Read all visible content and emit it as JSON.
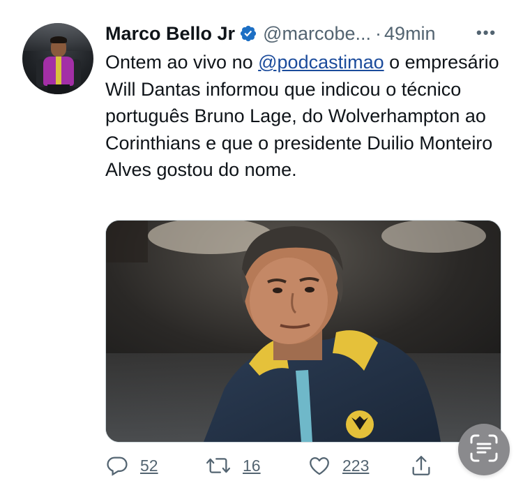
{
  "tweet": {
    "author_name": "Marco Bello Jr",
    "handle": "@marcobe...",
    "separator": "·",
    "time": "49min",
    "more_label": "•••",
    "text_before_mention": "Ontem ao vivo no ",
    "mention": "@podcastimao",
    "text_after_mention": " o empresário Will Dantas informou que indicou o técnico português Bruno Lage, do Wolverhampton ao Corinthians e que o presidente Duilio Monteiro Alves gostou do nome."
  },
  "actions": {
    "reply_count": "52",
    "retweet_count": "16",
    "like_count": "223"
  },
  "icons": {
    "verified": "verified-badge-icon",
    "reply": "reply-icon",
    "retweet": "retweet-icon",
    "like": "heart-icon",
    "share": "share-icon",
    "live_text": "scan-text-icon"
  },
  "colors": {
    "verified": "#1d6fc4",
    "mention": "#1b4b9b",
    "secondary_text": "#536471",
    "fab": "#8a8a8d"
  }
}
